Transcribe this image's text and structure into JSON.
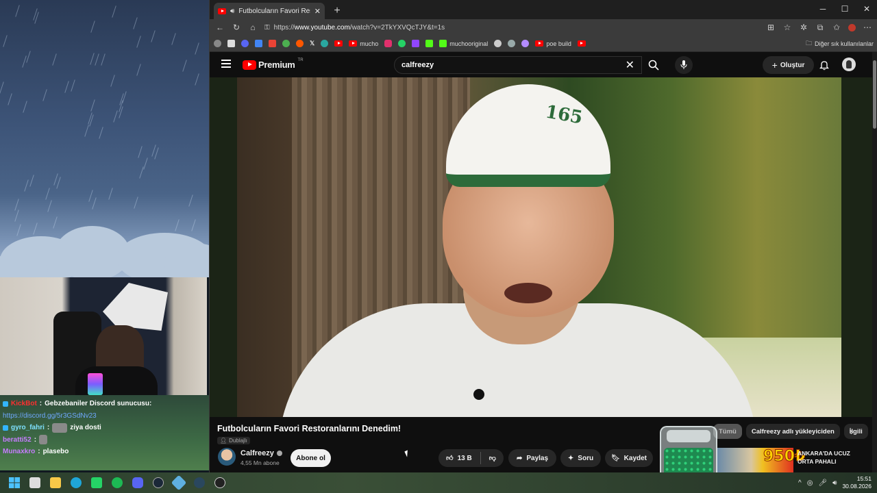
{
  "chat": [
    {
      "user": "KickBot",
      "text": "Gebzebaniler Discord sunucusu:"
    },
    {
      "user": "",
      "link": "https://discord.gg/5r3GSdNv23"
    },
    {
      "user": "gyro_fahri",
      "text": "ziya dosti"
    },
    {
      "user": "beratti52",
      "text": ""
    },
    {
      "user": "Munaxkro",
      "text": "plasebo"
    }
  ],
  "browser": {
    "tab_title": "Futbolcuların Favori Restoranları",
    "url_prefix": "https://",
    "url_host": "www.youtube.com",
    "url_rest": "/watch?v=2TkYXVQcTJY&t=1s",
    "bookmarks": [
      "mucho",
      "muchooriginal",
      "poe build"
    ],
    "other_bookmarks": "Diğer sık kullanılanlar"
  },
  "youtube": {
    "logo_text": "Premium",
    "logo_region": "TR",
    "search_value": "calfreezy",
    "create_label": "Oluştur",
    "video_title": "Futbolcuların Favori Restoranlarını Denedim!",
    "dubbed_label": "Dublajlı",
    "channel_name": "Calfreezy",
    "subscribers": "4,55 Mn abone",
    "subscribe_label": "Abone ol",
    "like_count": "13 B",
    "share_label": "Paylaş",
    "ask_label": "Soru",
    "save_label": "Kaydet",
    "chips": [
      "Tümü",
      "Calfreezy adlı yükleyiciden",
      "İlgili"
    ],
    "ad_price": "950₺",
    "ad_text": "ANKARA'DA UCUZ ORTA PAHALI"
  },
  "video_overlay": {
    "cap_logo": "165"
  },
  "taskbar": {
    "time": "15:51",
    "date": "30.08.2026"
  },
  "colors": {
    "youtube_red": "#ff0000",
    "bg": "#0f0f0f",
    "chip_bg": "#272727"
  }
}
